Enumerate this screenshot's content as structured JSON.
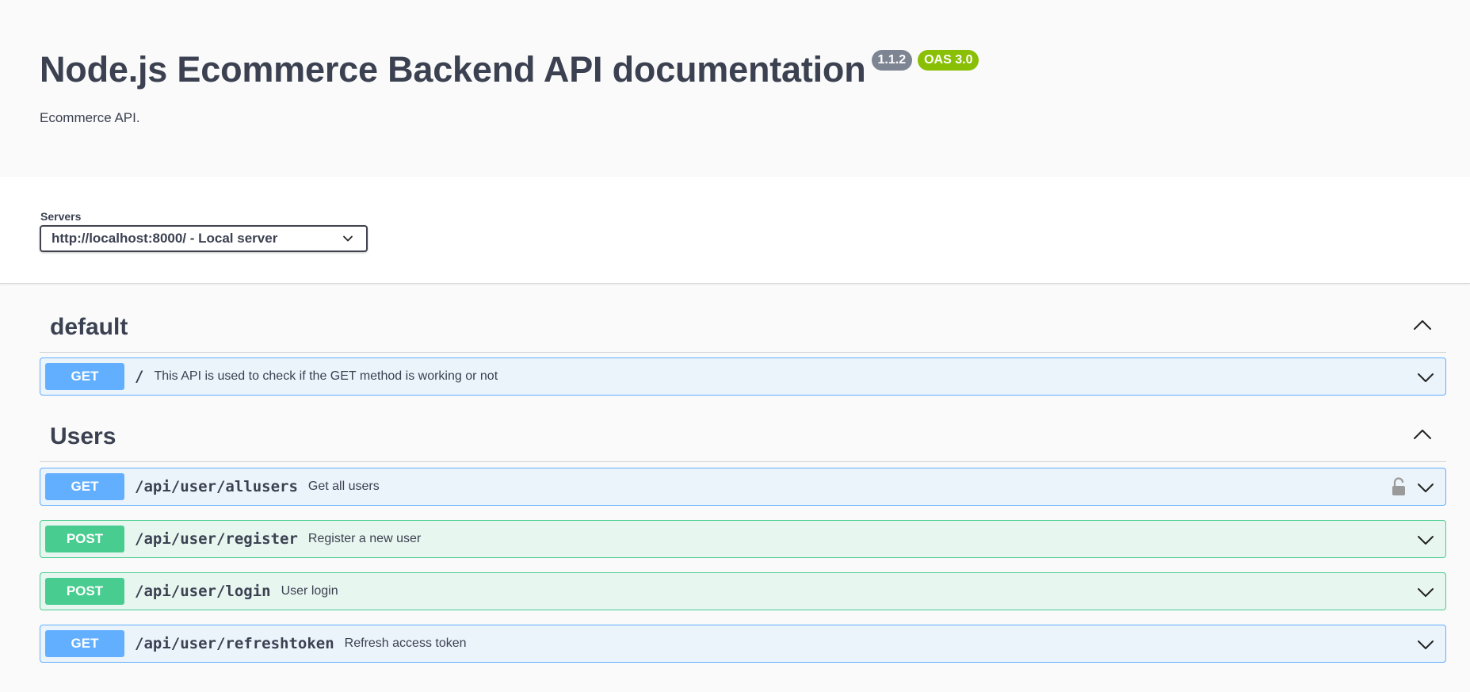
{
  "info": {
    "title": "Node.js Ecommerce Backend API documentation",
    "version": "1.1.2",
    "oas": "OAS 3.0",
    "description": "Ecommerce API."
  },
  "servers": {
    "label": "Servers",
    "selected": "http://localhost:8000/ - Local server"
  },
  "tags": [
    {
      "name": "default",
      "operations": [
        {
          "method": "GET",
          "path": "/",
          "summary": "This API is used to check if the GET method is working or not",
          "locked": false
        }
      ]
    },
    {
      "name": "Users",
      "operations": [
        {
          "method": "GET",
          "path": "/api/user/allusers",
          "summary": "Get all users",
          "locked": true
        },
        {
          "method": "POST",
          "path": "/api/user/register",
          "summary": "Register a new user",
          "locked": false
        },
        {
          "method": "POST",
          "path": "/api/user/login",
          "summary": "User login",
          "locked": false
        },
        {
          "method": "GET",
          "path": "/api/user/refreshtoken",
          "summary": "Refresh access token",
          "locked": false
        }
      ]
    }
  ],
  "colors": {
    "get": "#61affe",
    "post": "#49cc90",
    "version_badge": "#7d8492",
    "oas_badge": "#89bf04"
  },
  "icons": {
    "select_chevron": "chevron-down-icon",
    "tag_toggle": "chevron-up-icon",
    "op_toggle": "chevron-down-icon",
    "lock": "lock-open-icon"
  }
}
